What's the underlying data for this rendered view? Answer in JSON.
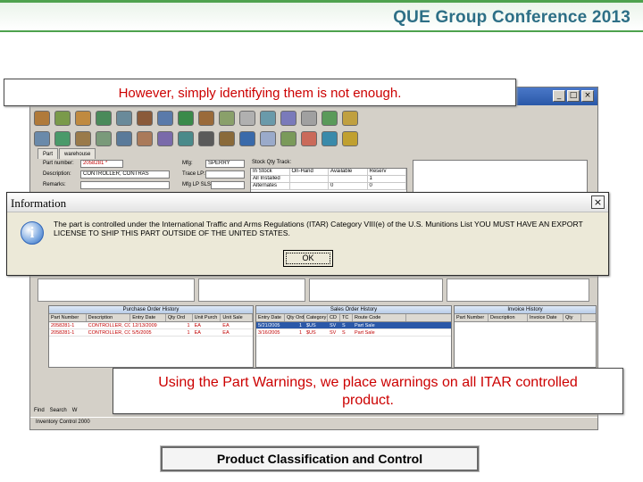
{
  "header": {
    "conference_title": "QUE Group Conference 2013"
  },
  "callouts": {
    "top": "However, simply identifying them is not enough.",
    "middle": "Using the Part Warnings, we place warnings on all ITAR controlled product."
  },
  "footer": {
    "label": "Product Classification and Control"
  },
  "app": {
    "window_controls": [
      "_",
      "□",
      "×"
    ],
    "tabs": [
      "Part",
      "warehouse"
    ],
    "form": {
      "part_number_label": "Part number:",
      "part_number_value": "2058281 *",
      "description_label": "Description:",
      "description_value": "CONTROLLER, CONTRAS",
      "remarks_label": "Remarks:",
      "mfg_label": "Mfg:",
      "mfg_value": "SPERRY",
      "trace_label": "Trace LP:",
      "mfg_lp_label": "Mfg LP SLS:",
      "stock_label": "Stock Qty Track:"
    },
    "stock_grid": {
      "headers": [
        "In Stock",
        "On-Hand",
        "Available",
        "Reserv"
      ],
      "rows": [
        [
          "All Installed",
          "",
          "",
          "1"
        ],
        [
          "Alternates",
          "",
          "0",
          "0"
        ]
      ]
    },
    "purchase_history": {
      "title": "Purchase Order History",
      "headers": [
        "Part Number",
        "Description",
        "Entry Date",
        "Qty Ord",
        "Unit Purch",
        "Unit Sale"
      ],
      "rows": [
        [
          "2058281-1",
          "CONTROLLER, CO",
          "12/13/2009",
          "1",
          "EA",
          "EA"
        ],
        [
          "2058281-1",
          "CONTROLLER, CO",
          "5/5/2005",
          "1",
          "EA",
          "EA"
        ]
      ]
    },
    "sales_history": {
      "title": "Sales Order History",
      "headers": [
        "Entry Date",
        "Qty Ord",
        "Category",
        "CD",
        "TC",
        "Route Code"
      ],
      "rows": [
        [
          "5/21/2005",
          "1",
          "$US",
          "SV",
          "S",
          "Part Sale"
        ],
        [
          "3/16/2005",
          "1",
          "$US",
          "SV",
          "S",
          "Part Sale"
        ]
      ]
    },
    "invoice_history": {
      "title": "Invoice History",
      "headers": [
        "Part Number",
        "Description",
        "Invoice Date",
        "Qty"
      ]
    },
    "bottom_toolbar": [
      "Find",
      "Search",
      "W"
    ],
    "status": "Inventory Control 2000"
  },
  "dialog": {
    "title": "Information",
    "icon": "information-icon",
    "message": "The part is controlled under the International Traffic and Arms Regulations (ITAR) Category VIII(e) of the U.S. Munitions List YOU MUST HAVE AN EXPORT LICENSE TO SHIP THIS PART OUTSIDE OF THE UNITED STATES.",
    "ok_label": "OK",
    "close_glyph": "×"
  },
  "colors": {
    "brand_blue": "#2d6f86",
    "brand_green": "#4ea24e",
    "callout_red": "#cc0000"
  }
}
